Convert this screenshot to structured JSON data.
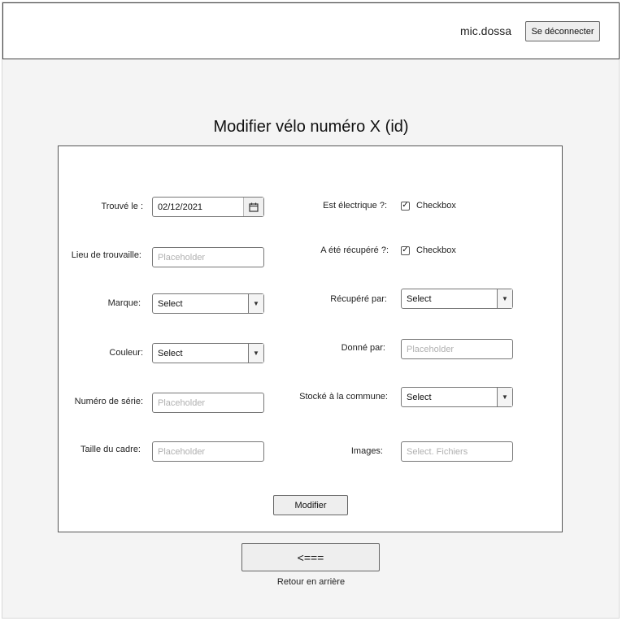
{
  "header": {
    "username": "mic.dossa",
    "logout_label": "Se déconnecter"
  },
  "page": {
    "title": "Modifier vélo numéro X (id)"
  },
  "form": {
    "found_on": {
      "label": "Trouvé le :",
      "value": "02/12/2021"
    },
    "location": {
      "label": "Lieu de trouvaille:",
      "placeholder": "Placeholder"
    },
    "brand": {
      "label": "Marque:",
      "value": "Select"
    },
    "color": {
      "label": "Couleur:",
      "value": "Select"
    },
    "serial": {
      "label": "Numéro de série:",
      "placeholder": "Placeholder"
    },
    "frame_size": {
      "label": "Taille du cadre:",
      "placeholder": "Placeholder"
    },
    "electric": {
      "label": "Est électrique ?:",
      "checkbox_label": "Checkbox",
      "checked": true
    },
    "recovered": {
      "label": "A été récupéré ?:",
      "checkbox_label": "Checkbox",
      "checked": true
    },
    "recovered_by": {
      "label": "Récupéré par:",
      "value": "Select"
    },
    "given_by": {
      "label": "Donné par:",
      "placeholder": "Placeholder"
    },
    "stored_at": {
      "label": "Stocké à la commune:",
      "value": "Select"
    },
    "images": {
      "label": "Images:",
      "placeholder": "Select. Fichiers"
    },
    "submit_label": "Modifier"
  },
  "back": {
    "arrow_label": "<===",
    "caption": "Retour en arrière"
  },
  "icons": {
    "calendar": "calendar-icon",
    "dropdown": "triangle-down",
    "check": "✓"
  }
}
